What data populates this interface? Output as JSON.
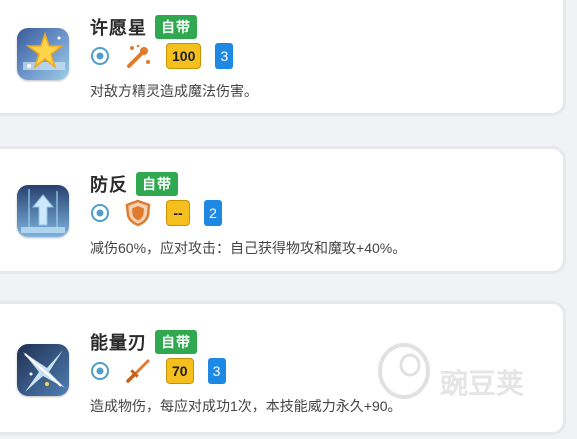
{
  "skills": [
    {
      "name": "许愿星",
      "tag": "自带",
      "power": "100",
      "pp": "3",
      "description": "对敌方精灵造成魔法伤害。",
      "icon": "wishing-star-icon",
      "type_icon": "magic-wand-icon",
      "target_icon": "target-icon"
    },
    {
      "name": "防反",
      "tag": "自带",
      "power": "--",
      "pp": "2",
      "description": "减伤60%，应对攻击：自己获得物攻和魔攻+40%。",
      "icon": "counter-defense-icon",
      "type_icon": "shield-icon",
      "target_icon": "target-icon"
    },
    {
      "name": "能量刃",
      "tag": "自带",
      "power": "70",
      "pp": "3",
      "description": "造成物伤，每应对成功1次，本技能威力永久+90。",
      "icon": "energy-blade-icon",
      "type_icon": "sword-icon",
      "target_icon": "target-icon"
    }
  ],
  "colors": {
    "tag_green": "#2fa84f",
    "power_yellow": "#f5bf1d",
    "pp_blue": "#1e88e5",
    "target_blue": "#4f9fc9",
    "type_orange": "#e07b2e"
  },
  "watermark": {
    "text": "豌豆荚",
    "icon": "watermark-logo-icon"
  }
}
